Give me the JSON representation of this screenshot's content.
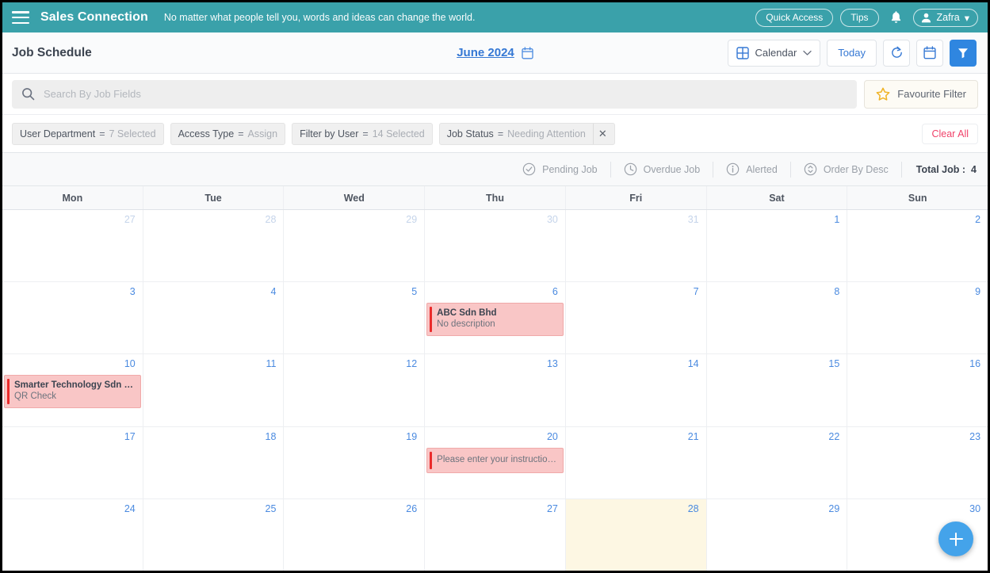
{
  "topbar": {
    "menu_icon": "hamburger-icon",
    "brand": "Sales Connection",
    "tagline": "No matter what people tell you, words and ideas can change the world.",
    "quick_access_label": "Quick Access",
    "tips_label": "Tips",
    "bell_icon": "notification-bell-icon",
    "user_name": "Zafra",
    "user_icon": "user-avatar-icon",
    "chevron": "▾",
    "bg_color": "#3aa1aa"
  },
  "subheader": {
    "page_title": "Job Schedule",
    "month_label": "June 2024",
    "month_icon": "calendar-picker-icon",
    "view_label": "Calendar",
    "view_icon": "grid-view-icon",
    "view_chevron": "chevron-down-icon",
    "today_label": "Today",
    "refresh_icon": "refresh-icon",
    "date_icon": "calendar-icon",
    "filter_icon": "funnel-filter-icon",
    "filter_active_color": "#2f86e0"
  },
  "search": {
    "icon": "search-icon",
    "placeholder": "Search By Job Fields",
    "value": "",
    "favourite_filter_label": "Favourite Filter",
    "favourite_filter_icon": "star-icon"
  },
  "filters": {
    "chips": [
      {
        "key": "User Department",
        "eq": "=",
        "value": "7 Selected",
        "removable": false
      },
      {
        "key": "Access Type",
        "eq": "=",
        "value": "Assign",
        "removable": false
      },
      {
        "key": "Filter by User",
        "eq": "=",
        "value": "14 Selected",
        "removable": false
      },
      {
        "key": "Job Status",
        "eq": "=",
        "value": "Needing Attention",
        "removable": true
      }
    ],
    "clear_all_label": "Clear All",
    "clear_all_color": "#f0426a"
  },
  "legend": {
    "items": [
      {
        "label": "Pending Job",
        "icon": "check-circle-icon"
      },
      {
        "label": "Overdue Job",
        "icon": "clock-circle-icon"
      },
      {
        "label": "Alerted",
        "icon": "info-circle-icon"
      },
      {
        "label": "Order By Desc",
        "icon": "sort-circle-icon"
      }
    ],
    "total_label": "Total Job :",
    "total_value": "4"
  },
  "calendar": {
    "day_names": [
      "Mon",
      "Tue",
      "Wed",
      "Thu",
      "Fri",
      "Sat",
      "Sun"
    ],
    "weeks": [
      [
        {
          "num": "27",
          "other": true
        },
        {
          "num": "28",
          "other": true
        },
        {
          "num": "29",
          "other": true
        },
        {
          "num": "30",
          "other": true
        },
        {
          "num": "31",
          "other": true
        },
        {
          "num": "1",
          "other": false
        },
        {
          "num": "2",
          "other": false
        }
      ],
      [
        {
          "num": "3",
          "other": false
        },
        {
          "num": "4",
          "other": false
        },
        {
          "num": "5",
          "other": false
        },
        {
          "num": "6",
          "other": false,
          "events": [
            {
              "title": "ABC Sdn Bhd",
              "desc": "No description"
            }
          ]
        },
        {
          "num": "7",
          "other": false
        },
        {
          "num": "8",
          "other": false
        },
        {
          "num": "9",
          "other": false
        }
      ],
      [
        {
          "num": "10",
          "other": false,
          "events": [
            {
              "title": "Smarter Technology Sdn Bh...",
              "desc": "QR Check"
            }
          ]
        },
        {
          "num": "11",
          "other": false
        },
        {
          "num": "12",
          "other": false
        },
        {
          "num": "13",
          "other": false
        },
        {
          "num": "14",
          "other": false
        },
        {
          "num": "15",
          "other": false
        },
        {
          "num": "16",
          "other": false
        }
      ],
      [
        {
          "num": "17",
          "other": false
        },
        {
          "num": "18",
          "other": false
        },
        {
          "num": "19",
          "other": false
        },
        {
          "num": "20",
          "other": false,
          "events": [
            {
              "title": "",
              "desc": "Please enter your instruction..."
            }
          ]
        },
        {
          "num": "21",
          "other": false
        },
        {
          "num": "22",
          "other": false
        },
        {
          "num": "23",
          "other": false
        }
      ],
      [
        {
          "num": "24",
          "other": false
        },
        {
          "num": "25",
          "other": false
        },
        {
          "num": "26",
          "other": false
        },
        {
          "num": "27",
          "other": false
        },
        {
          "num": "28",
          "other": false,
          "today": true
        },
        {
          "num": "29",
          "other": false
        },
        {
          "num": "30",
          "other": false
        }
      ]
    ],
    "event_bg": "#f9c6c6",
    "event_accent": "#ea2b2b",
    "today_bg": "#fdf7e3"
  },
  "fab": {
    "icon": "add-plus-icon",
    "color": "#44a3ea"
  }
}
